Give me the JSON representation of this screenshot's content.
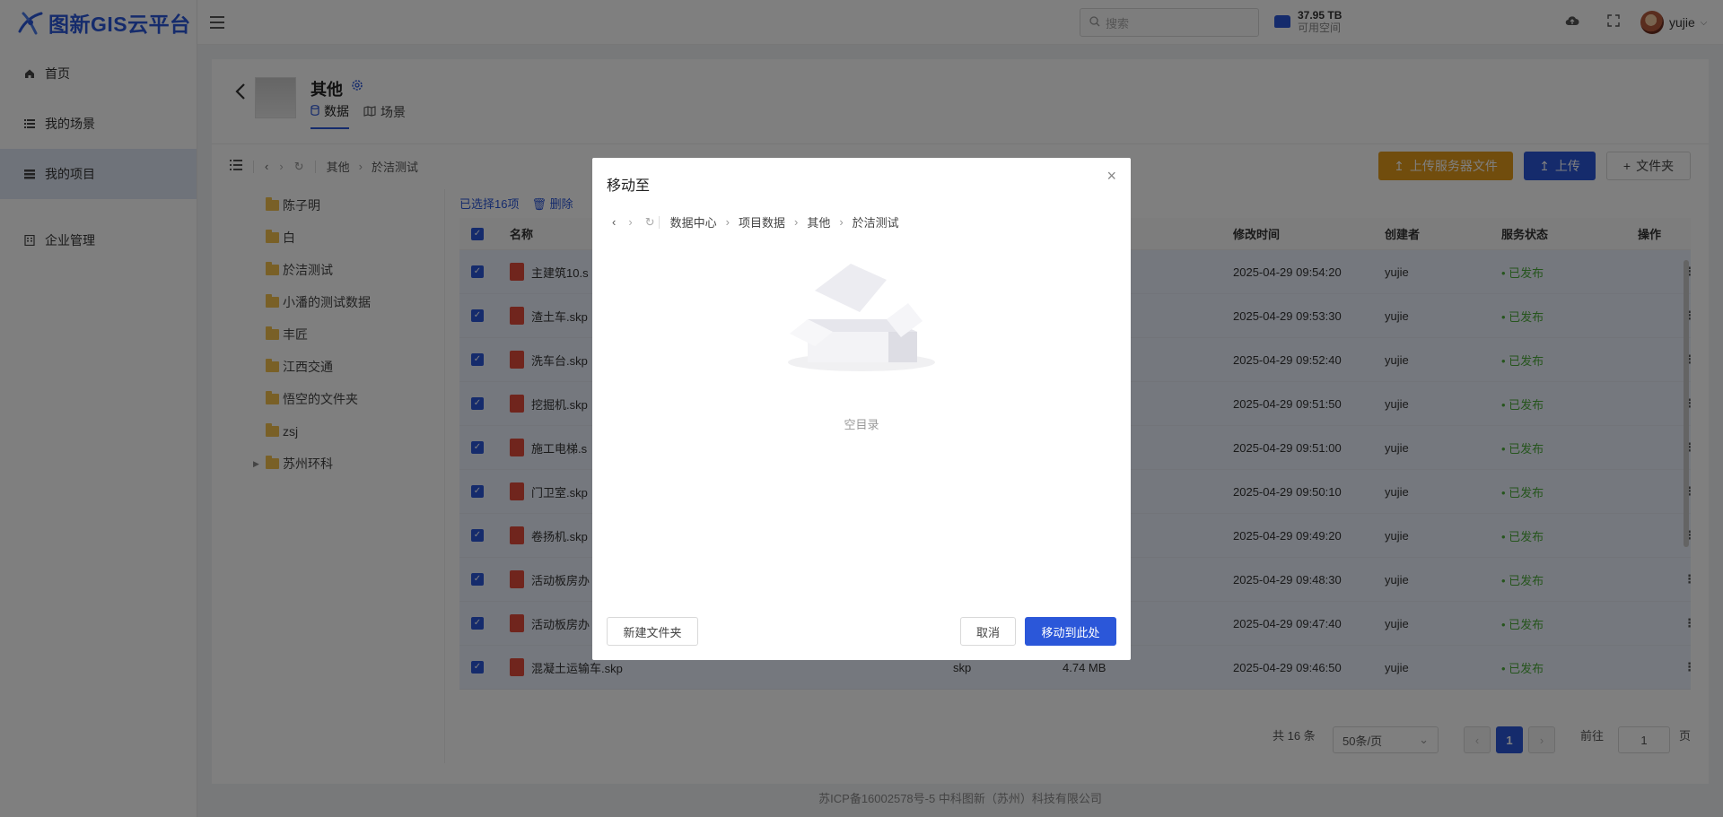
{
  "app": {
    "title": "图新GIS云平台"
  },
  "sidebar": {
    "items": [
      {
        "label": "首页",
        "icon": "home-icon",
        "active": false
      },
      {
        "label": "我的场景",
        "icon": "list-icon",
        "active": false
      },
      {
        "label": "我的项目",
        "icon": "project-icon",
        "active": true
      },
      {
        "label": "企业管理",
        "icon": "enterprise-icon",
        "active": false
      }
    ]
  },
  "header": {
    "search_placeholder": "搜索",
    "storage_size": "37.95 TB",
    "storage_label": "可用空间",
    "username": "yujie"
  },
  "project": {
    "title": "其他",
    "tabs": [
      {
        "label": "数据",
        "active": true
      },
      {
        "label": "场景",
        "active": false
      }
    ]
  },
  "toolbar": {
    "breadcrumb": [
      "其他",
      "於洁测试"
    ],
    "upload_server_label": "上传服务器文件",
    "upload_label": "上传",
    "folder_label": "文件夹"
  },
  "tree": {
    "folders": [
      "陈子明",
      "白",
      "於洁测试",
      "小潘的测试数据",
      "丰匠",
      "江西交通",
      "悟空的文件夹",
      "zsj",
      "苏州环科"
    ]
  },
  "selection": {
    "count_label": "已选择16项",
    "delete_label": "删除"
  },
  "table": {
    "columns": {
      "name": "名称",
      "modified": "修改时间",
      "creator": "创建者",
      "status": "服务状态",
      "ops": "操作"
    },
    "rows": [
      {
        "name": "主建筑10.s",
        "type": "",
        "size": "",
        "time": "2025-04-29 09:54:20",
        "creator": "yujie",
        "status": "• 已发布"
      },
      {
        "name": "渣土车.skp",
        "type": "",
        "size": "",
        "time": "2025-04-29 09:53:30",
        "creator": "yujie",
        "status": "• 已发布"
      },
      {
        "name": "洗车台.skp",
        "type": "",
        "size": "",
        "time": "2025-04-29 09:52:40",
        "creator": "yujie",
        "status": "• 已发布"
      },
      {
        "name": "挖掘机.skp",
        "type": "",
        "size": "",
        "time": "2025-04-29 09:51:50",
        "creator": "yujie",
        "status": "• 已发布"
      },
      {
        "name": "施工电梯.s",
        "type": "",
        "size": "",
        "time": "2025-04-29 09:51:00",
        "creator": "yujie",
        "status": "• 已发布"
      },
      {
        "name": "门卫室.skp",
        "type": "",
        "size": "",
        "time": "2025-04-29 09:50:10",
        "creator": "yujie",
        "status": "• 已发布"
      },
      {
        "name": "卷扬机.skp",
        "type": "",
        "size": "",
        "time": "2025-04-29 09:49:20",
        "creator": "yujie",
        "status": "• 已发布"
      },
      {
        "name": "活动板房办",
        "type": "",
        "size": "",
        "time": "2025-04-29 09:48:30",
        "creator": "yujie",
        "status": "• 已发布"
      },
      {
        "name": "活动板房办",
        "type": "",
        "size": "",
        "time": "2025-04-29 09:47:40",
        "creator": "yujie",
        "status": "• 已发布"
      },
      {
        "name": "混凝土运输车.skp",
        "type": "skp",
        "size": "4.74 MB",
        "time": "2025-04-29 09:46:50",
        "creator": "yujie",
        "status": "• 已发布"
      }
    ]
  },
  "pagination": {
    "total": "共 16 条",
    "page_size": "50条/页",
    "current": "1",
    "goto_label": "前往",
    "goto_value": "1",
    "page_suffix": "页"
  },
  "footer": {
    "text": "苏ICP备16002578号-5 中科图新（苏州）科技有限公司"
  },
  "modal": {
    "title": "移动至",
    "breadcrumb": [
      "数据中心",
      "项目数据",
      "其他",
      "於洁测试"
    ],
    "empty_text": "空目录",
    "new_folder_label": "新建文件夹",
    "cancel_label": "取消",
    "confirm_label": "移动到此处"
  },
  "colors": {
    "accent": "#2b57d9",
    "orange": "#e39a1a",
    "published": "#4caa3b"
  }
}
